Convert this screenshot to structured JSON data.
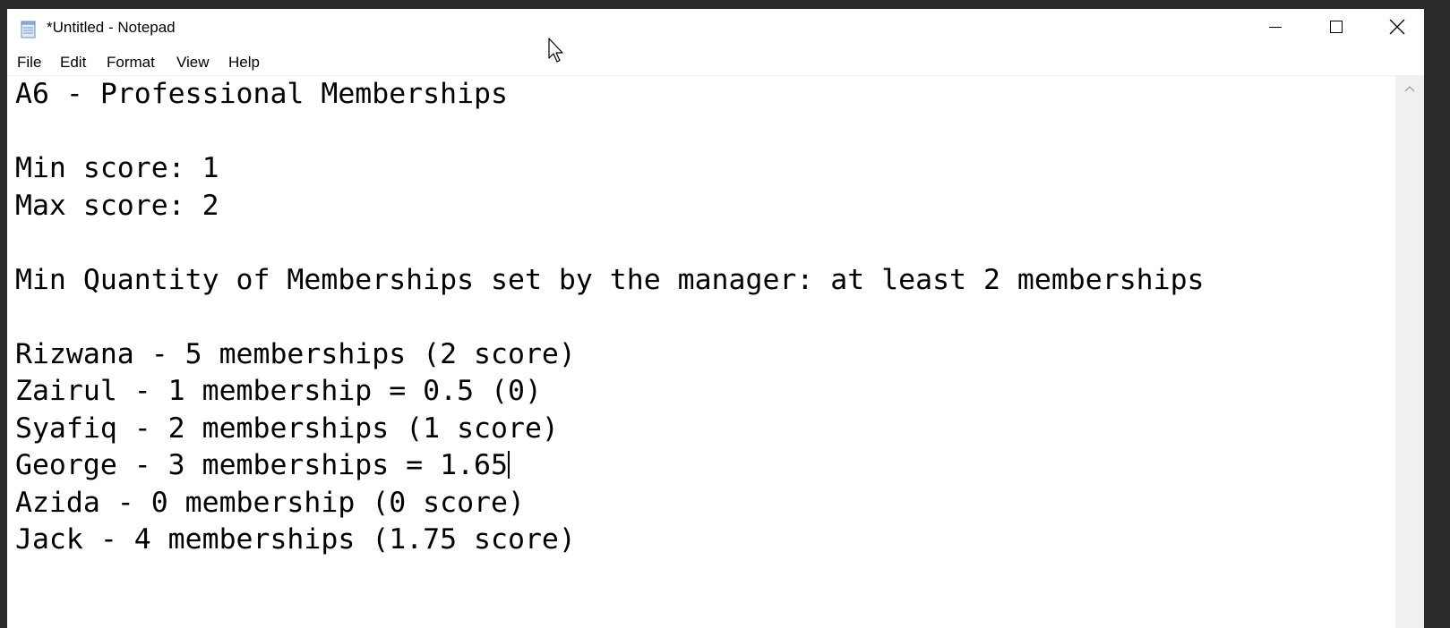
{
  "window": {
    "title": "*Untitled - Notepad"
  },
  "menu": {
    "file": "File",
    "edit": "Edit",
    "format": "Format",
    "view": "View",
    "help": "Help"
  },
  "editor": {
    "line1": "A6 - Professional Memberships",
    "line2": "",
    "line3": "Min score: 1",
    "line4": "Max score: 2",
    "line5": "",
    "line6": "Min Quantity of Memberships set by the manager: at least 2 memberships",
    "line7": "",
    "line8": "Rizwana - 5 memberships (2 score)",
    "line9": "Zairul - 1 membership = 0.5 (0)",
    "line10": "Syafiq - 2 memberships (1 score)",
    "line11": "George - 3 memberships = 1.65",
    "line12": "Azida - 0 membership (0 score)",
    "line13": "Jack - 4 memberships (1.75 score)"
  },
  "icons": {
    "app": "notepad-icon",
    "minimize": "minimize-icon",
    "maximize": "maximize-icon",
    "close": "close-icon",
    "scroll_up": "scroll-up-arrow-icon",
    "cursor": "mouse-pointer-icon"
  }
}
